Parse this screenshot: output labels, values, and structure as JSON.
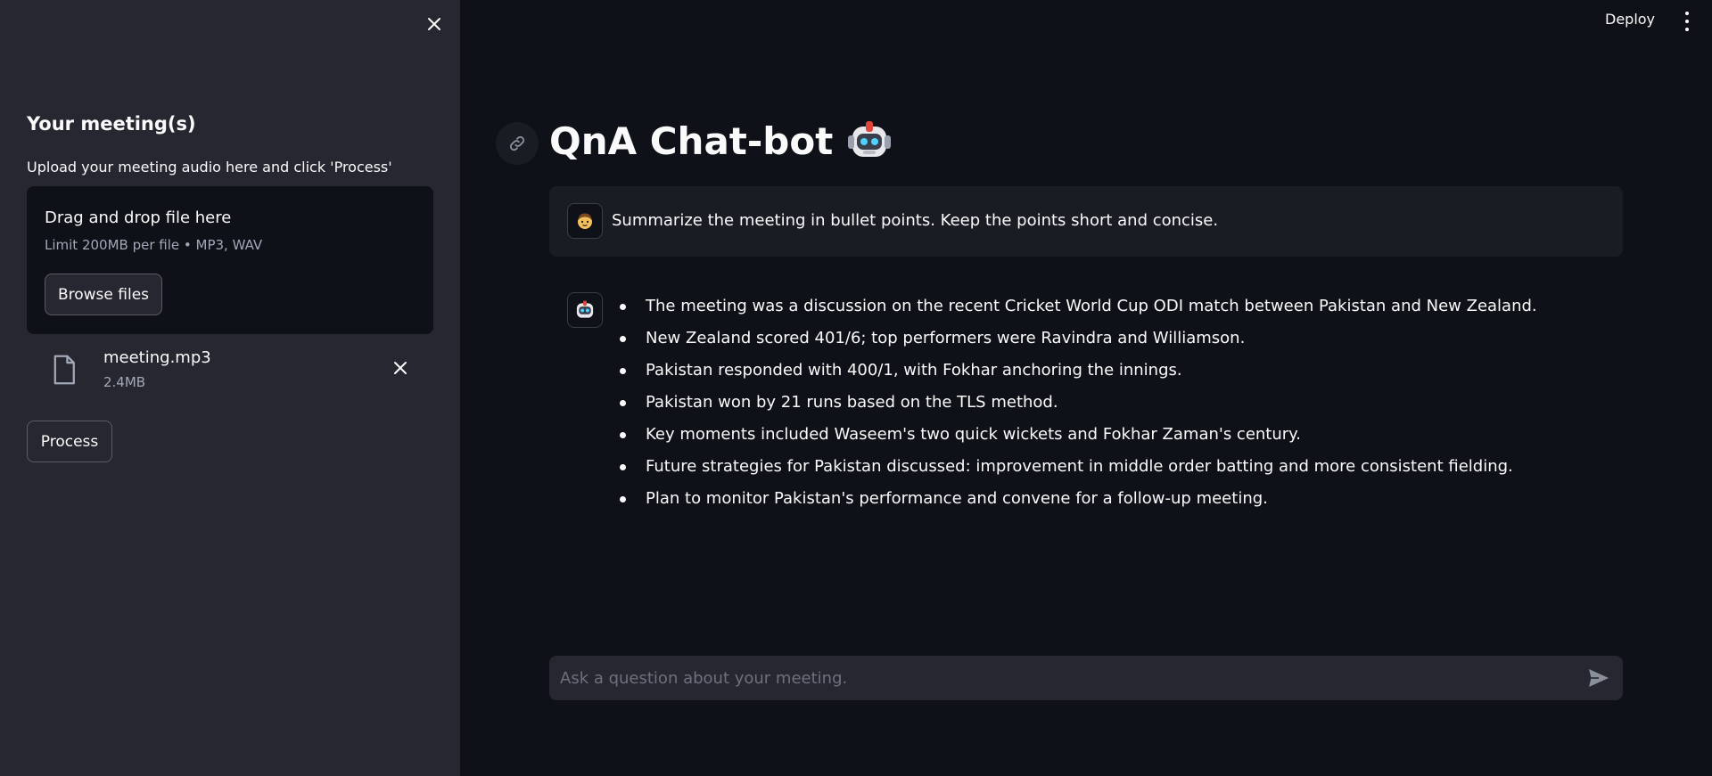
{
  "sidebar": {
    "close_icon": "close-icon",
    "title": "Your meeting(s)",
    "description": "Upload your meeting audio here and click 'Process'",
    "dropzone": {
      "title": "Drag and drop file here",
      "subtitle": "Limit 200MB per file • MP3, WAV",
      "browse_label": "Browse files"
    },
    "uploaded_file": {
      "name": "meeting.mp3",
      "size": "2.4MB",
      "icon": "file-icon",
      "remove_icon": "close-icon"
    },
    "process_label": "Process"
  },
  "header": {
    "deploy_label": "Deploy",
    "menu_icon": "kebab-menu-icon"
  },
  "main": {
    "title": "QnA Chat-bot",
    "title_icon": "robot-icon",
    "link_icon": "link-icon",
    "messages": [
      {
        "role": "user",
        "avatar": "user-avatar-icon",
        "text": "Summarize the meeting in bullet points. Keep the points short and concise."
      },
      {
        "role": "assistant",
        "avatar": "robot-avatar-icon",
        "bullets": [
          "The meeting was a discussion on the recent Cricket World Cup ODI match between Pakistan and New Zealand.",
          "New Zealand scored 401/6; top performers were Ravindra and Williamson.",
          "Pakistan responded with 400/1, with Fokhar anchoring the innings.",
          "Pakistan won by 21 runs based on the TLS method.",
          "Key moments included Waseem's two quick wickets and Fokhar Zaman's century.",
          "Future strategies for Pakistan discussed: improvement in middle order batting and more consistent fielding.",
          "Plan to monitor Pakistan's performance and convene for a follow-up meeting."
        ]
      }
    ],
    "chat_input": {
      "placeholder": "Ask a question about your meeting.",
      "value": "",
      "send_icon": "send-icon"
    }
  },
  "colors": {
    "background": "#0e1117",
    "sidebar": "#262730",
    "text": "#fafafa",
    "muted": "#a3a8b8"
  }
}
